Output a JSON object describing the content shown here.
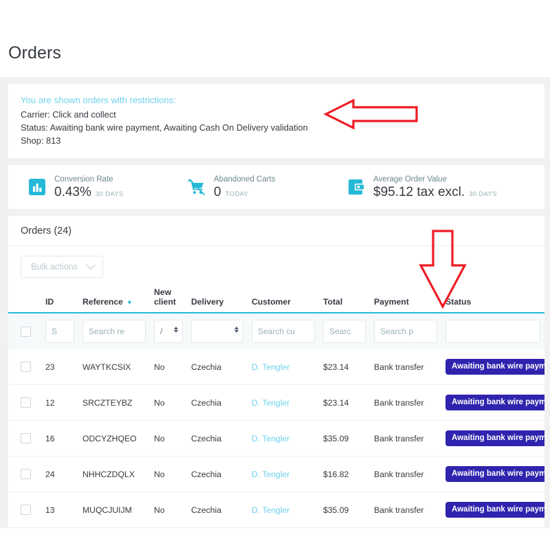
{
  "header": {
    "title": "Orders"
  },
  "restrictions": {
    "title": "You are shown orders with restrictions:",
    "carrier": "Carrier: Click and collect",
    "status": "Status: Awaiting bank wire payment, Awaiting Cash On Delivery validation",
    "shop": "Shop: 813"
  },
  "kpis": [
    {
      "icon": "bar-chart-icon",
      "label": "Conversion Rate",
      "value": "0.43%",
      "period": "30 DAYS"
    },
    {
      "icon": "abandoned-cart-icon",
      "label": "Abandoned Carts",
      "value": "0",
      "period": "TODAY"
    },
    {
      "icon": "wallet-icon",
      "label": "Average Order Value",
      "value": "$95.12 tax excl.",
      "period": "30 DAYS"
    }
  ],
  "orders_panel": {
    "heading": "Orders (24)",
    "bulk_actions_label": "Bulk actions",
    "columns": [
      "ID",
      "Reference",
      "New client",
      "Delivery",
      "Customer",
      "Total",
      "Payment",
      "Status"
    ],
    "sorted_column": "Reference",
    "filters": {
      "id": "S",
      "reference": "Search re",
      "new_client": "/",
      "delivery": "",
      "customer": "Search cu",
      "total": "Searc",
      "payment": "Search p",
      "status": ""
    },
    "rows": [
      {
        "id": "23",
        "reference": "WAYTKCSIX",
        "new_client": "No",
        "delivery": "Czechia",
        "customer": "D. Tengler",
        "total": "$23.14",
        "payment": "Bank transfer",
        "status": "Awaiting bank wire payment"
      },
      {
        "id": "12",
        "reference": "SRCZTEYBZ",
        "new_client": "No",
        "delivery": "Czechia",
        "customer": "D. Tengler",
        "total": "$23.14",
        "payment": "Bank transfer",
        "status": "Awaiting bank wire payment"
      },
      {
        "id": "16",
        "reference": "ODCYZHQEO",
        "new_client": "No",
        "delivery": "Czechia",
        "customer": "D. Tengler",
        "total": "$35.09",
        "payment": "Bank transfer",
        "status": "Awaiting bank wire payment"
      },
      {
        "id": "24",
        "reference": "NHHCZDQLX",
        "new_client": "No",
        "delivery": "Czechia",
        "customer": "D. Tengler",
        "total": "$16.82",
        "payment": "Bank transfer",
        "status": "Awaiting bank wire payment"
      },
      {
        "id": "13",
        "reference": "MUQCJUIJM",
        "new_client": "No",
        "delivery": "Czechia",
        "customer": "D. Tengler",
        "total": "$35.09",
        "payment": "Bank transfer",
        "status": "Awaiting bank wire payment"
      }
    ]
  },
  "colors": {
    "accent_cyan": "#25b9d7",
    "link_cyan": "#6fd1ec",
    "badge_indigo": "#3023ae",
    "annotation_red": "#ee1c24"
  }
}
